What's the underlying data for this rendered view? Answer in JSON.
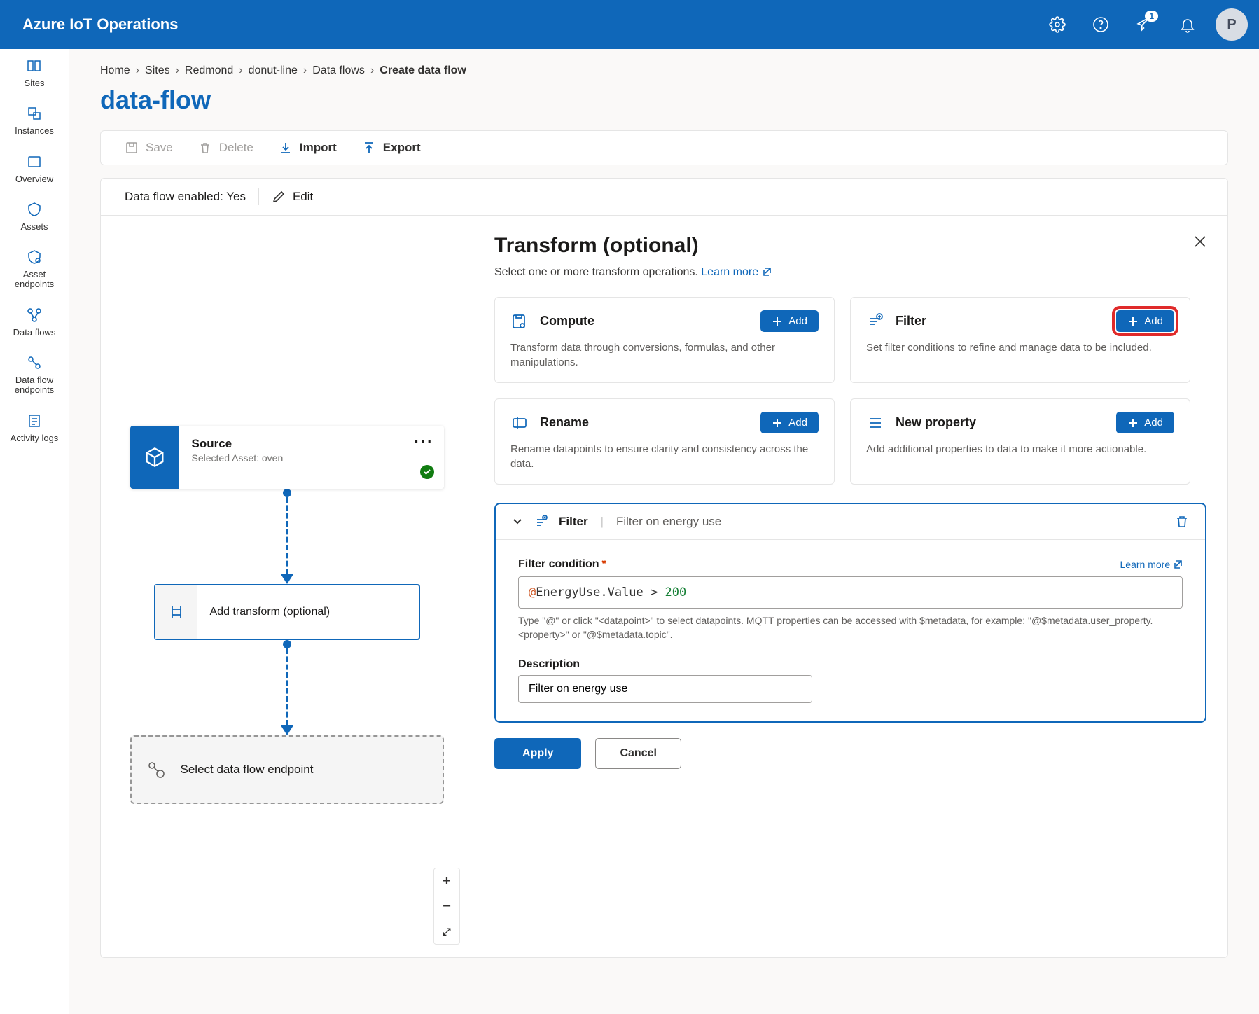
{
  "header": {
    "title": "Azure IoT Operations",
    "avatar_initial": "P",
    "feedback_badge": "1"
  },
  "sidebar": {
    "items": [
      {
        "label": "Sites"
      },
      {
        "label": "Instances"
      },
      {
        "label": "Overview"
      },
      {
        "label": "Assets"
      },
      {
        "label": "Asset endpoints"
      },
      {
        "label": "Data flows"
      },
      {
        "label": "Data flow endpoints"
      },
      {
        "label": "Activity logs"
      }
    ]
  },
  "breadcrumbs": [
    "Home",
    "Sites",
    "Redmond",
    "donut-line",
    "Data flows",
    "Create data flow"
  ],
  "page_title": "data-flow",
  "toolbar": {
    "save": "Save",
    "delete": "Delete",
    "import": "Import",
    "export": "Export"
  },
  "status": {
    "label": "Data flow enabled: Yes",
    "edit": "Edit"
  },
  "canvas": {
    "source": {
      "title": "Source",
      "subtitle": "Selected Asset: oven"
    },
    "transform_step": "Add transform (optional)",
    "endpoint_step": "Select data flow endpoint"
  },
  "detail": {
    "title": "Transform (optional)",
    "subtitle": "Select one or more transform operations.",
    "learn_more": "Learn more",
    "add_label": "Add",
    "ops": [
      {
        "name": "Compute",
        "desc": "Transform data through conversions, formulas, and other manipulations."
      },
      {
        "name": "Filter",
        "desc": "Set filter conditions to refine and manage data to be included."
      },
      {
        "name": "Rename",
        "desc": "Rename datapoints to ensure clarity and consistency across the data."
      },
      {
        "name": "New property",
        "desc": "Add additional properties to data to make it more actionable."
      }
    ],
    "filter_block": {
      "pill_title": "Filter",
      "pill_sub": "Filter on energy use",
      "condition_label": "Filter condition",
      "condition_value": "@EnergyUse.Value > 200",
      "hint": "Type \"@\" or click \"<datapoint>\" to select datapoints. MQTT properties can be accessed with $metadata, for example: \"@$metadata.user_property.<property>\" or \"@$metadata.topic\".",
      "description_label": "Description",
      "description_value": "Filter on energy use"
    },
    "apply": "Apply",
    "cancel": "Cancel"
  }
}
